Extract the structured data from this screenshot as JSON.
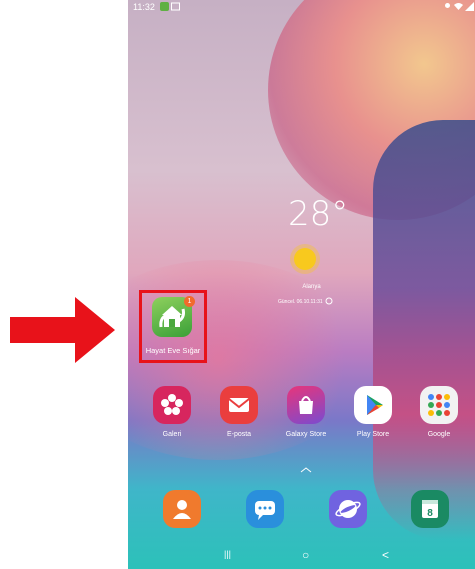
{
  "status_bar": {
    "time": "11:32"
  },
  "weather": {
    "temperature": "28°",
    "city": "Alanya",
    "updated": "Güncel. 06.10.11:31"
  },
  "highlighted_app": {
    "label": "Hayat Eve Sığar",
    "badge": "1"
  },
  "apps": [
    {
      "label": "Galeri",
      "icon": "gallery-icon",
      "color": "#d7265e"
    },
    {
      "label": "E-posta",
      "icon": "email-icon",
      "color": "#ea3e3e"
    },
    {
      "label": "Galaxy Store",
      "icon": "galaxy-store-icon",
      "color": "#d8346a"
    },
    {
      "label": "Play Store",
      "icon": "play-store-icon",
      "color": "#ffffff"
    },
    {
      "label": "Google",
      "icon": "google-folder-icon",
      "color": "#f2f2f2"
    }
  ],
  "dock": [
    {
      "icon": "contacts-icon",
      "color": "#f07a2d"
    },
    {
      "icon": "messages-icon",
      "color": "#2a8fdc"
    },
    {
      "icon": "internet-icon",
      "color": "#7063e0"
    },
    {
      "icon": "calendar-icon",
      "color": "#1a8a63",
      "text": "8"
    }
  ],
  "navigation": {
    "recents": "|||",
    "home": "○",
    "back": "<"
  },
  "colors": {
    "highlight": "#e8121a",
    "pointer": "#e8121a"
  }
}
